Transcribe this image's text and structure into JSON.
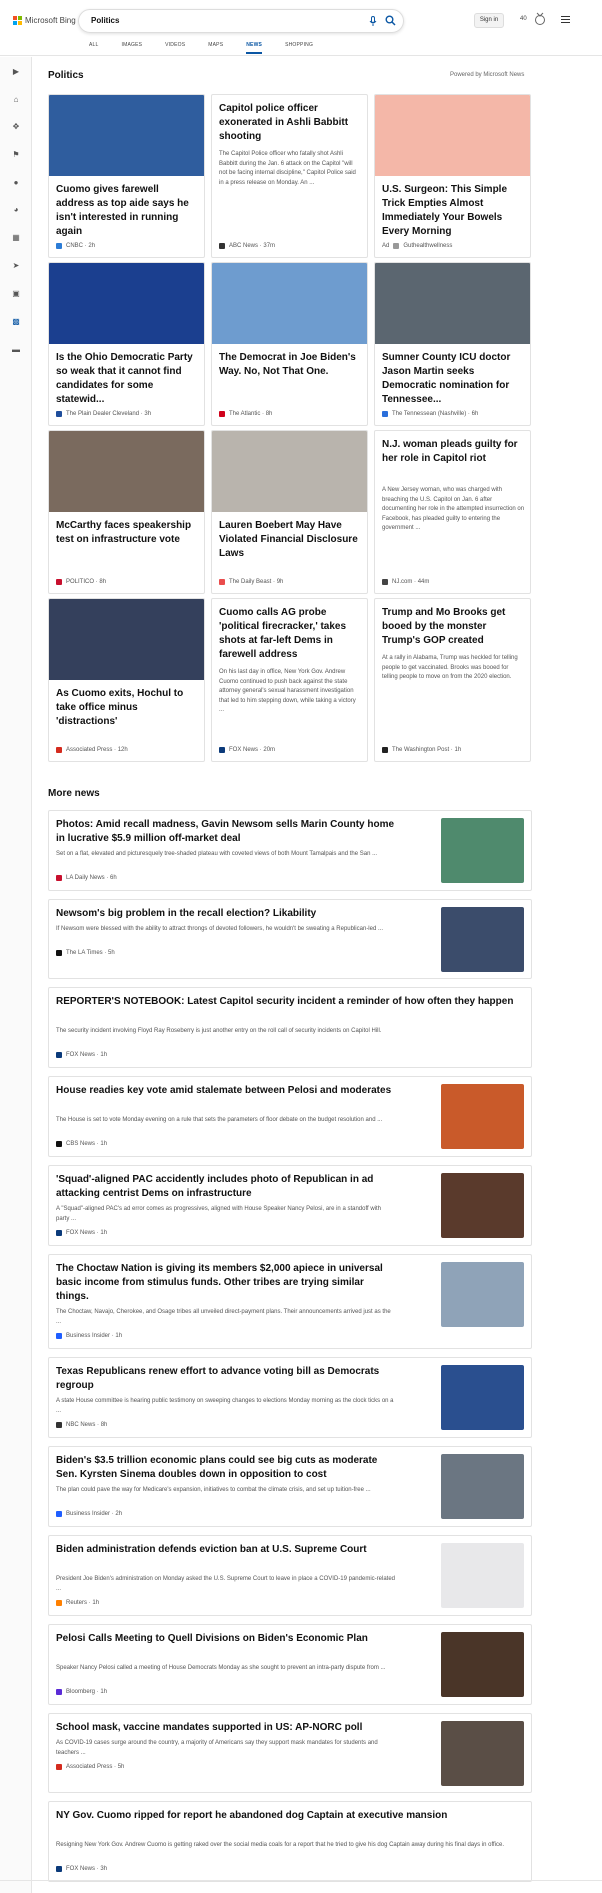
{
  "header": {
    "logo_text": "Microsoft Bing",
    "query": "Politics",
    "signin_label": "Sign in",
    "points": "40",
    "tabs": [
      "ALL",
      "IMAGES",
      "VIDEOS",
      "MAPS",
      "NEWS",
      "SHOPPING"
    ],
    "active_tab": "NEWS"
  },
  "section": {
    "title": "Politics",
    "powered": "Powered by Microsoft News"
  },
  "cards": [
    {
      "title": "Cuomo gives farewell address as top aide says he isn't interested in running again",
      "snippet": "",
      "source": "CNBC",
      "time": "2h",
      "color": "#2f5d9e",
      "ad": ""
    },
    {
      "title": "Capitol police officer exonerated in Ashli Babbitt shooting",
      "snippet": "The Capitol Police officer who fatally shot Ashli Babbitt during the Jan. 6 attack on the Capitol \"will not be facing internal discipline,\" Capitol Police said in a press release on Monday. An ...",
      "source": "ABC News",
      "time": "37m",
      "color": "",
      "ad": ""
    },
    {
      "title": "U.S. Surgeon: This Simple Trick Empties Almost Immediately Your Bowels Every Morning",
      "snippet": "",
      "source": "Guthealthwellness",
      "time": "",
      "color": "#f4b7a8",
      "ad": "Ad"
    },
    {
      "title": "Is the Ohio Democratic Party so weak that it cannot find candidates for some statewid...",
      "snippet": "",
      "source": "The Plain Dealer Cleveland",
      "time": "3h",
      "color": "#1b3f8f",
      "ad": ""
    },
    {
      "title": "The Democrat in Joe Biden's Way. No, Not That One.",
      "snippet": "",
      "source": "The Atlantic",
      "time": "8h",
      "color": "#6e9ccf",
      "ad": ""
    },
    {
      "title": "Sumner County ICU doctor Jason Martin seeks Democratic nomination for Tennessee...",
      "snippet": "",
      "source": "The Tennessean (Nashville)",
      "time": "6h",
      "color": "#5b6670",
      "ad": ""
    },
    {
      "title": "McCarthy faces speakership test on infrastructure vote",
      "snippet": "",
      "source": "POLITICO",
      "time": "8h",
      "color": "#7a6a5e",
      "ad": ""
    },
    {
      "title": "Lauren Boebert May Have Violated Financial Disclosure Laws",
      "snippet": "",
      "source": "The Daily Beast",
      "time": "9h",
      "color": "#b9b4ad",
      "ad": ""
    },
    {
      "title": "N.J. woman pleads guilty for her role in Capitol riot",
      "snippet": "A New Jersey woman, who was charged with breaching the U.S. Capitol on Jan. 6 after documenting her role in the attempted insurrection on Facebook, has pleaded guilty to entering the government ...",
      "source": "NJ.com",
      "time": "44m",
      "color": "",
      "ad": ""
    },
    {
      "title": "As Cuomo exits, Hochul to take office minus 'distractions'",
      "snippet": "",
      "source": "Associated Press",
      "time": "12h",
      "color": "#34405c",
      "ad": ""
    },
    {
      "title": "Cuomo calls AG probe 'political firecracker,' takes shots at far-left Dems in farewell address",
      "snippet": "On his last day in office, New York Gov. Andrew Cuomo continued to push back against the state attorney general's sexual harassment investigation that led to him stepping down, while taking a victory ...",
      "source": "FOX News",
      "time": "20m",
      "color": "",
      "ad": ""
    },
    {
      "title": "Trump and Mo Brooks get booed by the monster Trump's GOP created",
      "snippet": "At a rally in Alabama, Trump was heckled for telling people to get vaccinated. Brooks was booed for telling people to move on from the 2020 election.",
      "source": "The Washington Post",
      "time": "1h",
      "color": "",
      "ad": ""
    }
  ],
  "more_news": {
    "title": "More news",
    "items": [
      {
        "title": "Photos: Amid recall madness, Gavin Newsom sells Marin County home in lucrative $5.9 million off-market deal",
        "snippet": "Set on a flat, elevated and picturesquely tree-shaded plateau with coveted views of both Mount Tamalpais and the San ...",
        "source": "LA Daily News",
        "time": "6h",
        "color": "#4f8a6d"
      },
      {
        "title": "Newsom's big problem in the recall election? Likability",
        "snippet": "If Newsom were blessed with the ability to attract throngs of devoted followers, he wouldn't be sweating a Republican-led ...",
        "source": "The LA Times",
        "time": "5h",
        "color": "#3b4c6b"
      },
      {
        "title": "REPORTER'S NOTEBOOK: Latest Capitol security incident a reminder of how often they happen",
        "snippet": "The security incident involving Floyd Ray Roseberry is just another entry on the roll call of security incidents on Capitol Hill.",
        "source": "FOX News",
        "time": "1h",
        "color": ""
      },
      {
        "title": "House readies key vote amid stalemate between Pelosi and moderates",
        "snippet": "The House is set to vote Monday evening on a rule that sets the parameters of floor debate on the budget resolution and ...",
        "source": "CBS News",
        "time": "1h",
        "color": "#c95a2a"
      },
      {
        "title": "'Squad'-aligned PAC accidently includes photo of Republican in ad attacking centrist Dems on infrastructure",
        "snippet": "A \"Squad\"-aligned PAC's ad error comes as progressives, aligned with House Speaker Nancy Pelosi, are in a standoff with party ...",
        "source": "FOX News",
        "time": "1h",
        "color": "#5a3a2c"
      },
      {
        "title": "The Choctaw Nation is giving its members $2,000 apiece in universal basic income from stimulus funds. Other tribes are trying similar things.",
        "snippet": "The Choctaw, Navajo, Cherokee, and Osage tribes all unveiled direct-payment plans. Their announcements arrived just as the ...",
        "source": "Business Insider",
        "time": "1h",
        "color": "#8fa3b8"
      },
      {
        "title": "Texas Republicans renew effort to advance voting bill as Democrats regroup",
        "snippet": "A state House committee is hearing public testimony on sweeping changes to elections Monday morning as the clock ticks on a ...",
        "source": "NBC News",
        "time": "8h",
        "color": "#2a4f8f"
      },
      {
        "title": "Biden's $3.5 trillion economic plans could see big cuts as moderate Sen. Kyrsten Sinema doubles down in opposition to cost",
        "snippet": "The plan could pave the way for Medicare's expansion, initiatives to combat the climate crisis, and set up tuition-free ...",
        "source": "Business Insider",
        "time": "2h",
        "color": "#6b7682"
      },
      {
        "title": "Biden administration defends eviction ban at U.S. Supreme Court",
        "snippet": "President Joe Biden's administration on Monday asked the U.S. Supreme Court to leave in place a COVID-19 pandemic-related ...",
        "source": "Reuters",
        "time": "1h",
        "color": "#e8e8ea"
      },
      {
        "title": "Pelosi Calls Meeting to Quell Divisions on Biden's Economic Plan",
        "snippet": "Speaker Nancy Pelosi called a meeting of House Democrats Monday as she sought to prevent an intra-party dispute from ...",
        "source": "Bloomberg",
        "time": "1h",
        "color": "#4a3528"
      },
      {
        "title": "School mask, vaccine mandates supported in US: AP-NORC poll",
        "snippet": "As COVID-19 cases surge around the country, a majority of Americans say they support mask mandates for students and teachers ...",
        "source": "Associated Press",
        "time": "5h",
        "color": "#5a4e46"
      },
      {
        "title": "NY Gov. Cuomo ripped for report he abandoned dog Captain at executive mansion",
        "snippet": "Resigning New York Gov. Andrew Cuomo is getting raked over the social media coals for a report that he tried to give his dog Captain away during his final days in office.",
        "source": "FOX News",
        "time": "3h",
        "color": ""
      }
    ]
  },
  "source_colors": {
    "CNBC": "#2c7cd6",
    "ABC News": "#333333",
    "Guthealthwellness": "#999999",
    "The Plain Dealer Cleveland": "#1f4e9c",
    "The Atlantic": "#d0021b",
    "The Tennessean (Nashville)": "#2a6fdb",
    "POLITICO": "#c8102e",
    "The Daily Beast": "#ea4c4c",
    "NJ.com": "#444444",
    "Associated Press": "#d42b1e",
    "FOX News": "#0b3a7a",
    "The Washington Post": "#222222",
    "LA Daily News": "#c8102e",
    "The LA Times": "#111111",
    "CBS News": "#111111",
    "Business Insider": "#1f5eff",
    "NBC News": "#333333",
    "Reuters": "#ff8000",
    "Bloomberg": "#5b2bd6"
  }
}
